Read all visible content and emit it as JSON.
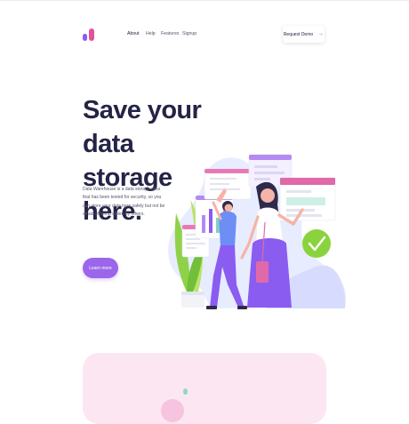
{
  "colors": {
    "accent": "#9b66ea",
    "brand_pink": "#e0529a",
    "title": "#252447",
    "card_pink": "#fbe6f1"
  },
  "header": {
    "logo_icon": "logo-icon",
    "nav": [
      "About",
      "Help",
      "Features",
      "Signup"
    ],
    "request_demo_label": "Request Demo",
    "request_demo_icon": "arrow-right-icon"
  },
  "hero": {
    "title_line1": "Save your data",
    "title_line2": "storage here.",
    "description": "Data Warehouse is a data storage area that has been tested for security, so you can store your data here safely but not be afraid of being stolen by others.",
    "cta_label": "Learn more"
  },
  "illustration": {
    "name": "data-storage-illustration",
    "check_icon": "check-icon"
  }
}
